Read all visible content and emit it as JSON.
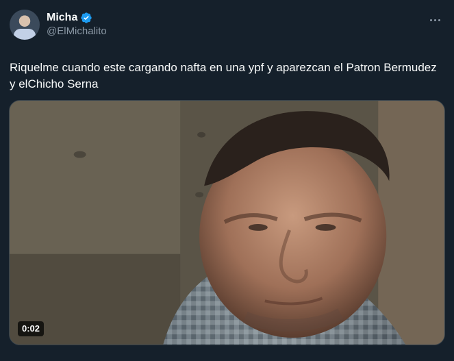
{
  "user": {
    "display_name": "Micha",
    "handle": "@ElMichalito",
    "avatar_icon": "user-avatar",
    "verified_icon": "verified-badge-icon",
    "verified_color": "#1d9bf0"
  },
  "tweet": {
    "text": "Riquelme cuando este cargando nafta en una ypf y aparezcan el Patron Bermudez y elChicho Serna"
  },
  "actions": {
    "more_icon": "more-options-icon"
  },
  "media": {
    "type": "video",
    "timestamp": "0:02"
  }
}
